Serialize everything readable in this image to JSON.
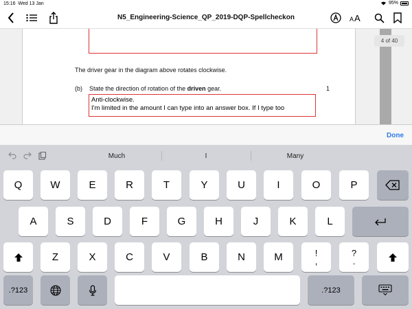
{
  "status": {
    "time": "15:16",
    "date": "Wed 13 Jan",
    "battery": "95%",
    "battery_level": 0.95
  },
  "toolbar": {
    "title": "N5_Engineering-Science_QP_2019-DQP-Spellcheckon"
  },
  "document": {
    "driver_text": "The driver gear in the diagram above rotates clockwise.",
    "question_label": "(b)",
    "question_prefix": "State the direction of rotation of the ",
    "question_bold": "driven",
    "question_suffix": " gear.",
    "marks": "1",
    "answer_line1": "Anti-clockwise.",
    "answer_line2": "I'm limited in the amount I can type into an answer box. If I type too",
    "page_counter": "4 of 40"
  },
  "accessory": {
    "done_label": "Done"
  },
  "suggestions": [
    "Much",
    "I",
    "Many"
  ],
  "keys": {
    "row1": [
      "Q",
      "W",
      "E",
      "R",
      "T",
      "Y",
      "U",
      "I",
      "O",
      "P"
    ],
    "row2": [
      "A",
      "S",
      "D",
      "F",
      "G",
      "H",
      "J",
      "K",
      "L"
    ],
    "row3": [
      "Z",
      "X",
      "C",
      "V",
      "B",
      "N",
      "M"
    ],
    "punct1": {
      "top": "!",
      "bottom": ","
    },
    "punct2": {
      "top": "?",
      "bottom": "."
    },
    "numbers_label": ".?123"
  },
  "colors": {
    "accent": "#2f7ae5",
    "answer_border": "#dd3333",
    "keyboard_bg": "#d2d4d9"
  }
}
